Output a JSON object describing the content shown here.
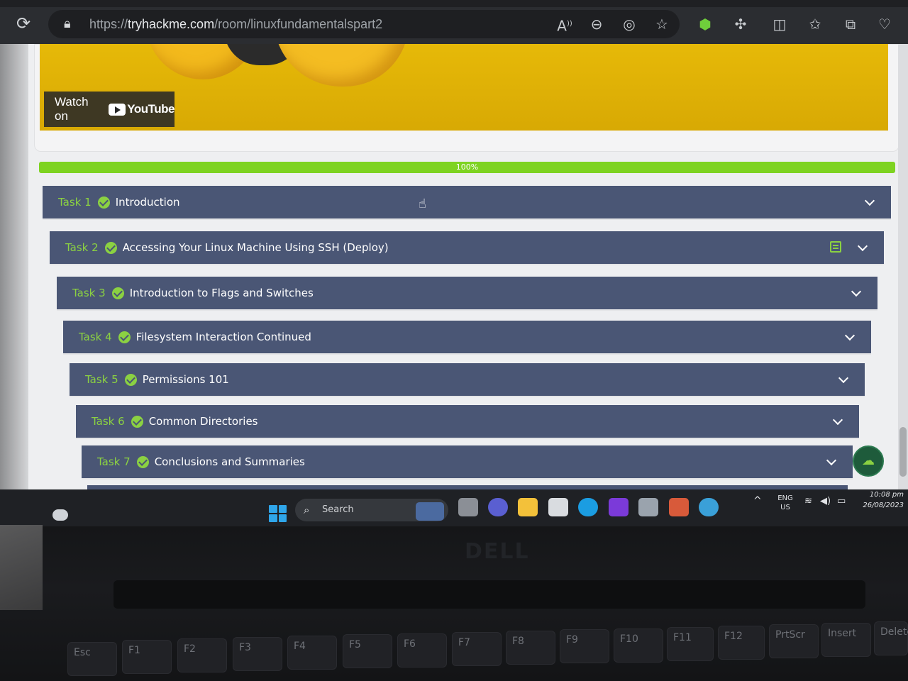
{
  "browser": {
    "url_prefix": "https://",
    "url_host": "tryhackme.com",
    "url_path": "/room/linuxfundamentalspart2"
  },
  "video": {
    "watch_on": "Watch on",
    "youtube": "YouTube"
  },
  "progress": {
    "label": "100%",
    "value": 100
  },
  "tasks": [
    {
      "num": "Task 1",
      "title": "Introduction"
    },
    {
      "num": "Task 2",
      "title": "Accessing Your Linux Machine Using SSH (Deploy)"
    },
    {
      "num": "Task 3",
      "title": "Introduction to Flags and Switches"
    },
    {
      "num": "Task 4",
      "title": "Filesystem Interaction Continued"
    },
    {
      "num": "Task 5",
      "title": "Permissions 101"
    },
    {
      "num": "Task 6",
      "title": "Common Directories"
    },
    {
      "num": "Task 7",
      "title": "Conclusions and Summaries"
    }
  ],
  "taskbar": {
    "search": "Search",
    "lang": "ENG",
    "region": "US",
    "time": "10:08 pm",
    "date": "26/08/2023"
  },
  "laptop": {
    "brand": "DELL"
  },
  "keyboard": {
    "keys": [
      "Esc",
      "F1",
      "F2",
      "F3",
      "F4",
      "F5",
      "F6",
      "F7",
      "F8",
      "F9",
      "F10",
      "F11",
      "F12",
      "PrtScr",
      "Insert",
      "Delete"
    ]
  },
  "colors": {
    "task_bg": "#4a5675",
    "accent_green": "#8bd142",
    "progress_green": "#7ed321"
  }
}
